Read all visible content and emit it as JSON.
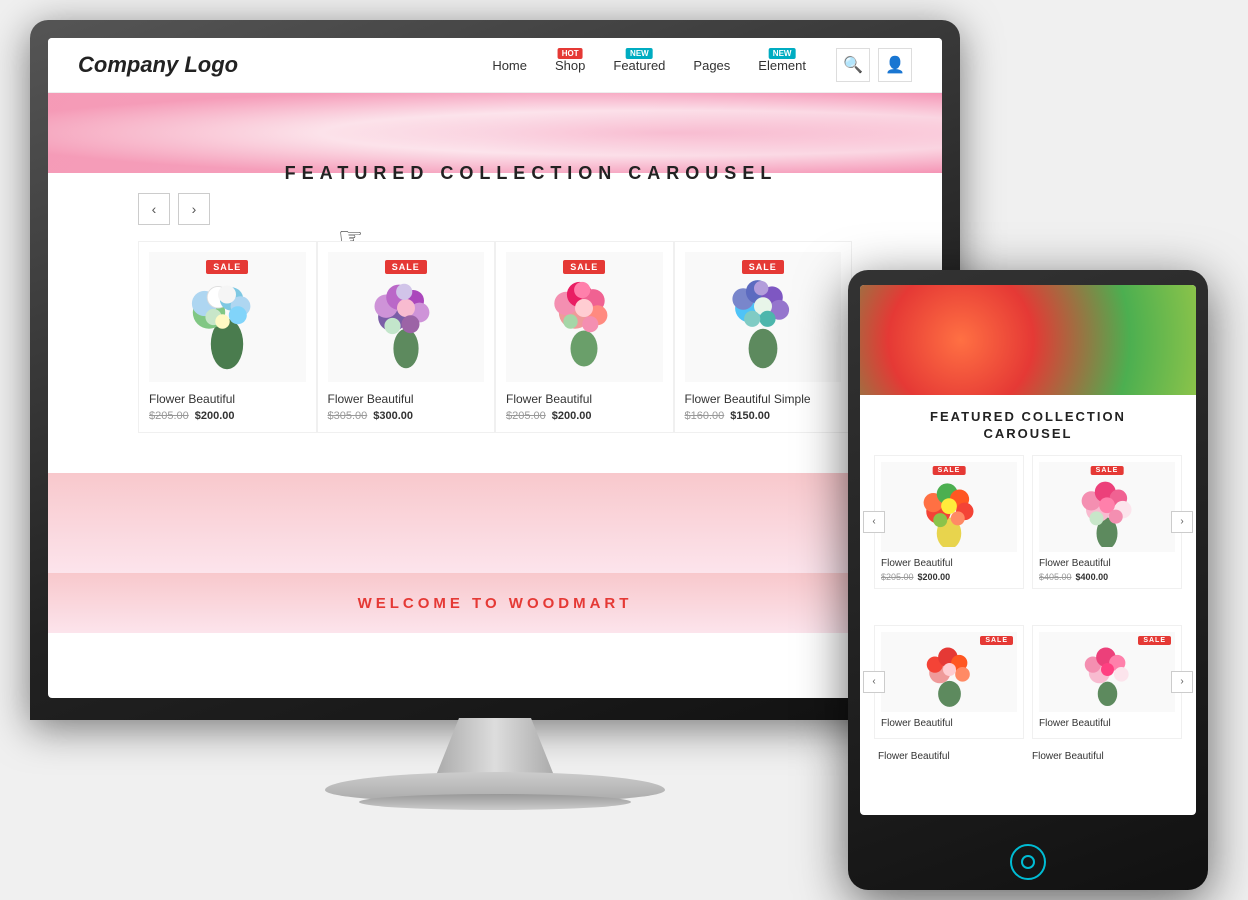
{
  "monitor": {
    "label": "Desktop Monitor"
  },
  "website": {
    "logo": "Company Logo",
    "nav": {
      "items": [
        {
          "label": "Home",
          "badge": null
        },
        {
          "label": "Shop",
          "badge": "HOT",
          "badge_type": "hot"
        },
        {
          "label": "Featured",
          "badge": "NEW",
          "badge_type": "new"
        },
        {
          "label": "Pages",
          "badge": null
        },
        {
          "label": "Element",
          "badge": "NEW",
          "badge_type": "new"
        }
      ]
    },
    "carousel": {
      "title": "FEATURED COLLECTION CAROUSEL",
      "prev_label": "‹",
      "next_label": "›",
      "products": [
        {
          "name": "Flower Beautiful",
          "price_old": "$205.00",
          "price_new": "$200.00",
          "sale": true
        },
        {
          "name": "Flower Beautiful",
          "price_old": "$305.00",
          "price_new": "$300.00",
          "sale": true
        },
        {
          "name": "Flower Beautiful",
          "price_old": "$205.00",
          "price_new": "$200.00",
          "sale": true
        },
        {
          "name": "Flower Beautiful Simple",
          "price_old": "$160.00",
          "price_new": "$150.00",
          "sale": true
        }
      ]
    },
    "welcome": "WELCOME TO WOODMART"
  },
  "tablet": {
    "carousel": {
      "title": "FEATURED COLLECTION\nCAROUSEL",
      "products": [
        {
          "name": "Flower Beautiful",
          "price_old": "$205.00",
          "price_new": "$200.00",
          "sale": true
        },
        {
          "name": "Flower Beautiful",
          "price_old": "$405.00",
          "price_new": "$400.00",
          "sale": true
        }
      ]
    },
    "carousel2": {
      "products": [
        {
          "name": "Flower Beautiful",
          "sale": true
        },
        {
          "name": "Flower Beautiful",
          "sale": true
        }
      ]
    },
    "bottom_products": [
      {
        "name": "Flower Beautiful"
      },
      {
        "name": "Flower Beautiful"
      }
    ]
  },
  "icons": {
    "search": "🔍",
    "user": "👤",
    "prev": "‹",
    "next": "›",
    "power": "⏻"
  },
  "colors": {
    "sale_badge": "#e53935",
    "hot_badge": "#e53935",
    "new_badge": "#00acc1",
    "accent": "#e53935",
    "text_dark": "#222222",
    "text_muted": "#999999"
  }
}
